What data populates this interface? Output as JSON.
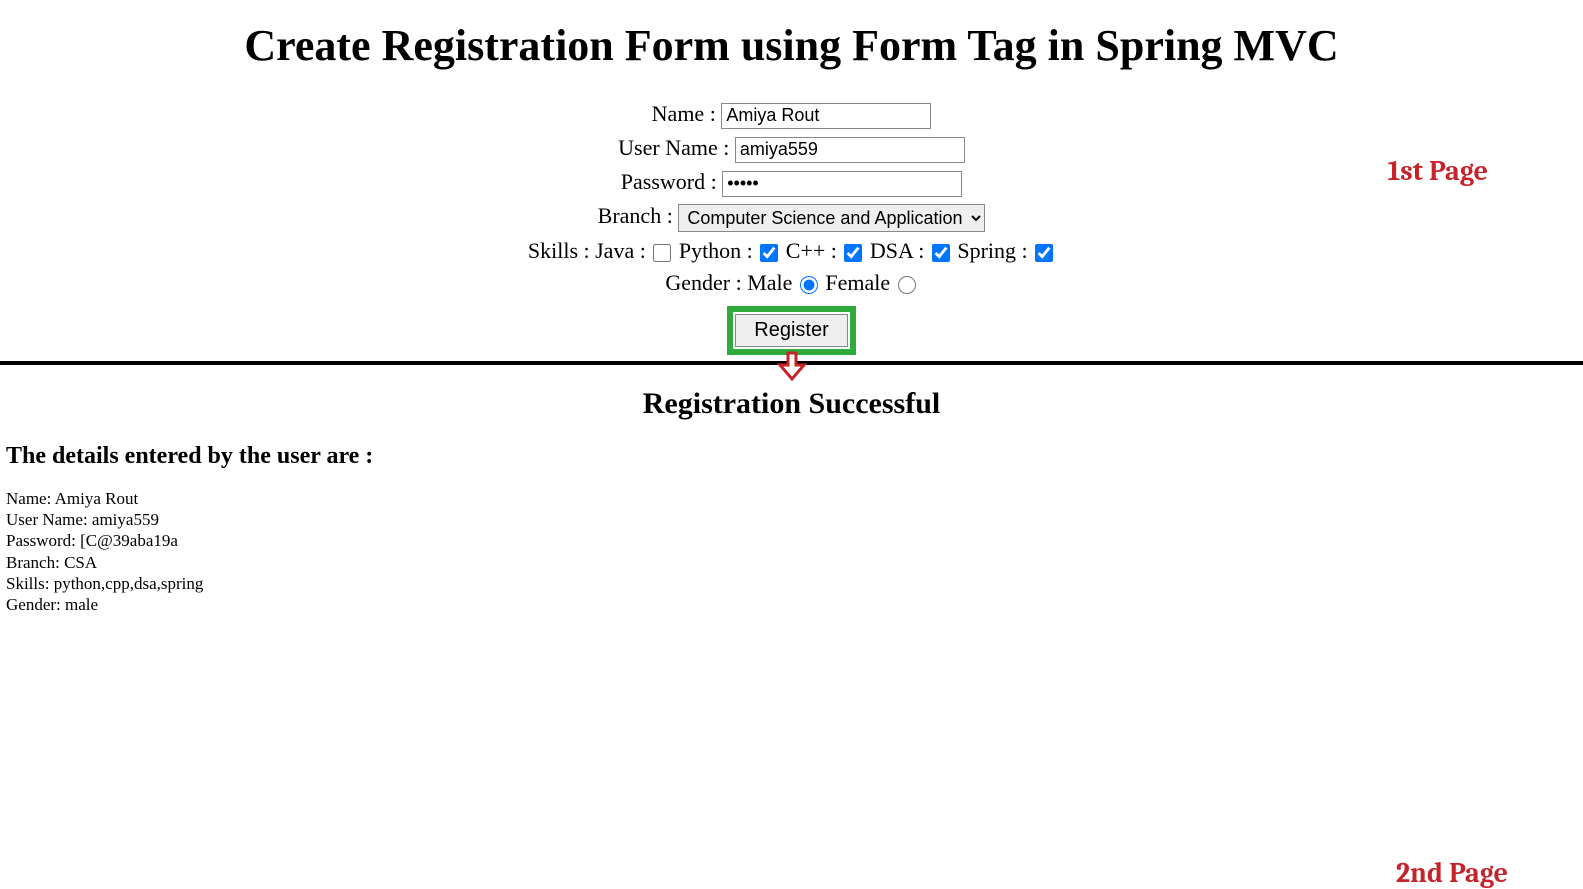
{
  "page1": {
    "title": "Create Registration Form using Form Tag in Spring MVC",
    "labels": {
      "name": "Name :",
      "username": "User Name :",
      "password": "Password :",
      "branch": "Branch :",
      "skills": "Skills :",
      "gender": "Gender :"
    },
    "values": {
      "name": "Amiya Rout",
      "username": "amiya559",
      "password": "•••••",
      "branchSelected": "Computer Science and Application"
    },
    "skills": {
      "java": {
        "label": "Java :",
        "checked": false
      },
      "python": {
        "label": "Python :",
        "checked": true
      },
      "cpp": {
        "label": "C++ :",
        "checked": true
      },
      "dsa": {
        "label": "DSA :",
        "checked": true
      },
      "spring": {
        "label": "Spring :",
        "checked": true
      }
    },
    "gender": {
      "male": {
        "label": "Male",
        "checked": true
      },
      "female": {
        "label": "Female",
        "checked": false
      }
    },
    "registerLabel": "Register",
    "annotation": "1st Page"
  },
  "page2": {
    "title": "Registration Successful",
    "detailsHeading": "The details entered by the user are :",
    "details": {
      "name": "Name: Amiya Rout",
      "username": "User Name: amiya559",
      "password": "Password: [C@39aba19a",
      "branch": "Branch: CSA",
      "skills": "Skills: python,cpp,dsa,spring",
      "gender": "Gender: male"
    },
    "annotation": "2nd Page"
  }
}
